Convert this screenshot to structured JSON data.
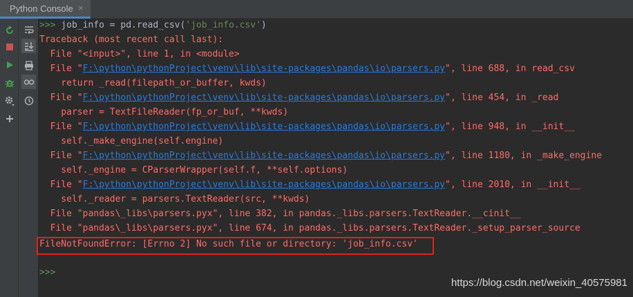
{
  "tab": {
    "title": "Python Console",
    "close": "×"
  },
  "console": {
    "prompt": ">>>",
    "command_pre": " job_info = pd.read_csv(",
    "command_str": "'job_info.csv'",
    "command_post": ")",
    "traceback": "Traceback (most recent call last):",
    "frame_input": "  File \"<input>\", line 1, in <module>",
    "file_prefix": "  File \"",
    "parsers_path": "F:\\python\\pythonProject\\venv\\lib\\site-packages\\pandas\\io\\parsers.py",
    "frames": [
      {
        "suffix": "\", line 688, in read_csv",
        "code": "    return _read(filepath_or_buffer, kwds)"
      },
      {
        "suffix": "\", line 454, in _read",
        "code": "    parser = TextFileReader(fp_or_buf, **kwds)"
      },
      {
        "suffix": "\", line 948, in __init__",
        "code": "    self._make_engine(self.engine)"
      },
      {
        "suffix": "\", line 1180, in _make_engine",
        "code": "    self._engine = CParserWrapper(self.f, **self.options)"
      },
      {
        "suffix": "\", line 2010, in __init__",
        "code": "    self._reader = parsers.TextReader(src, **kwds)"
      }
    ],
    "pyx_frames": [
      "  File \"pandas\\_libs\\parsers.pyx\", line 382, in pandas._libs.parsers.TextReader.__cinit__",
      "  File \"pandas\\_libs\\parsers.pyx\", line 674, in pandas._libs.parsers.TextReader._setup_parser_source"
    ],
    "error": "FileNotFoundError: [Errno 2] No such file or directory: 'job_info.csv'",
    "empty_prompt": ">>>"
  },
  "watermark": "https://blog.csdn.net/weixin_40575981",
  "toolbar_icons": [
    "rerun-icon",
    "stop-icon",
    "run-icon",
    "debug-icon",
    "settings-icon",
    "add-icon"
  ],
  "toolbar2_icons": [
    "soft-wrap-icon",
    "scroll-to-end-icon",
    "print-icon",
    "show-variables-icon",
    "history-icon"
  ],
  "colors": {
    "background": "#2b2b2b",
    "error_text": "#ff6b68",
    "prompt": "#629755",
    "link": "#287bde",
    "highlight_box": "#e0231a"
  }
}
